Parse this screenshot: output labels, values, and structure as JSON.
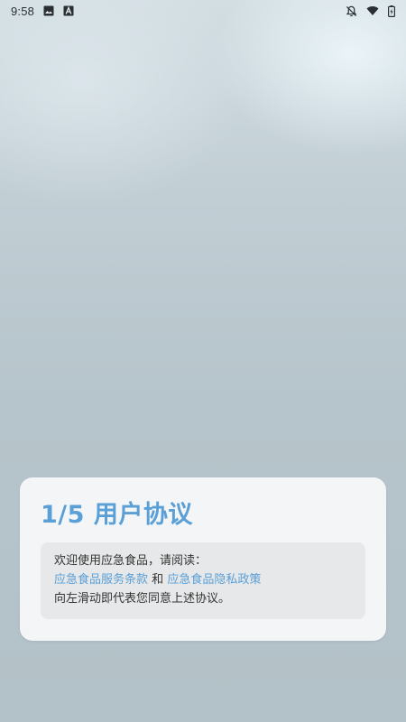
{
  "status_bar": {
    "time": "9:58",
    "left_icons": [
      "image-icon",
      "font-a-icon"
    ],
    "right_icons": [
      "bell-off-icon",
      "wifi-icon",
      "battery-icon"
    ]
  },
  "dialog": {
    "title": "1/5 用户协议",
    "welcome_text": "欢迎使用应急食品，请阅读：",
    "terms_link": "应急食品服务条款",
    "conjunction": "和",
    "privacy_link": "应急食品隐私政策",
    "swipe_text": "向左滑动即代表您同意上述协议。"
  },
  "colors": {
    "accent": "#5a9fd6",
    "card_bg": "#f4f5f6",
    "body_bg": "#e7e8e9"
  }
}
